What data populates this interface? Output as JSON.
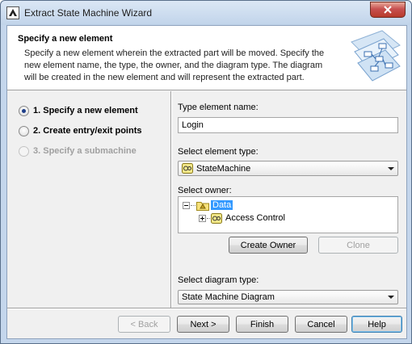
{
  "window": {
    "title": "Extract State Machine Wizard"
  },
  "header": {
    "title": "Specify a new element",
    "description": "Specify a new element wherein the extracted part will be moved. Specify the new element name, the type, the owner, and the diagram type. The diagram will be created in the new element and will represent the extracted part."
  },
  "steps": [
    {
      "label": "1. Specify a new element",
      "state": "selected"
    },
    {
      "label": "2. Create entry/exit points",
      "state": "enabled"
    },
    {
      "label": "3. Specify a submachine",
      "state": "disabled"
    }
  ],
  "form": {
    "name_label": "Type element name:",
    "name_value": "Login",
    "type_label": "Select element type:",
    "type_value": "StateMachine",
    "owner_label": "Select owner:",
    "tree": {
      "root": "Data",
      "child": "Access Control"
    },
    "create_owner_label": "Create Owner",
    "clone_label": "Clone",
    "diagram_label": "Select diagram type:",
    "diagram_value": "State Machine Diagram"
  },
  "buttons": {
    "back": "< Back",
    "next": "Next >",
    "finish": "Finish",
    "cancel": "Cancel",
    "help": "Help"
  },
  "colors": {
    "selection": "#3399ff",
    "close_button": "#c75050"
  }
}
